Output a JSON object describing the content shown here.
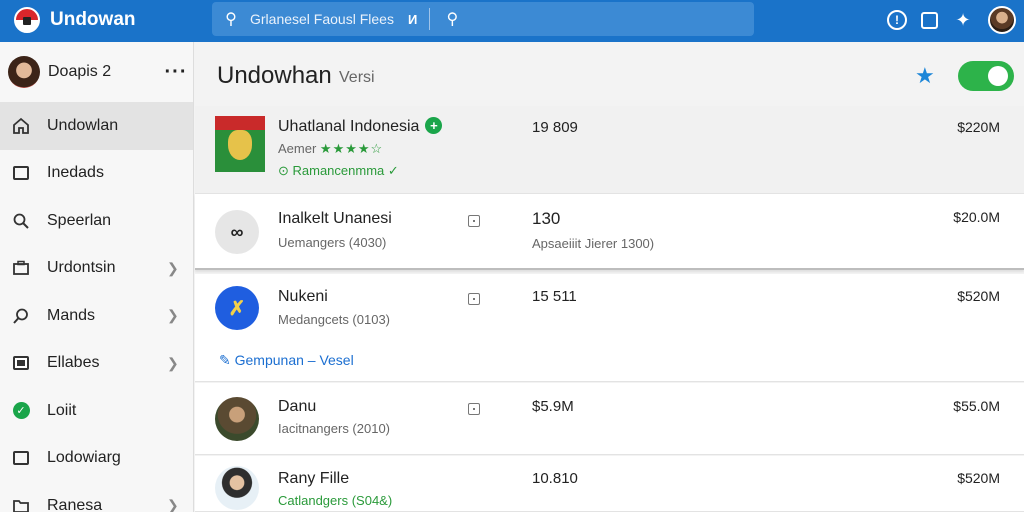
{
  "app": {
    "name": "Undowan"
  },
  "search": {
    "text": "Grlanesel Faousl Flees",
    "filter_label": "И"
  },
  "sidebar": {
    "user": {
      "name": "Doapis 2"
    },
    "items": [
      {
        "label": "Undowlan",
        "icon": "home-icon"
      },
      {
        "label": "Inedads",
        "icon": "inbox-icon"
      },
      {
        "label": "Speerlan",
        "icon": "search-icon"
      },
      {
        "label": "Urdontsin",
        "icon": "briefcase-icon"
      },
      {
        "label": "Mands",
        "icon": "magnifier-icon"
      },
      {
        "label": "Ellabes",
        "icon": "list-icon"
      },
      {
        "label": "Loiit",
        "icon": "check-icon"
      },
      {
        "label": "Lodowiarg",
        "icon": "message-icon"
      },
      {
        "label": "Ranesa",
        "icon": "folder-icon"
      }
    ]
  },
  "header": {
    "title": "Undowhan",
    "subtitle": "Versi"
  },
  "rows": [
    {
      "name": "Uhatlanal Indonesia",
      "sub_prefix": "Aemer",
      "stars": "★★★★☆",
      "link": "⊙ Ramancenmma ✓",
      "value": "19 809",
      "price": "$220M"
    },
    {
      "name": "Inalkelt Unanesi",
      "sub": "Uemangers (4030)",
      "value": "130",
      "value_sub": "Apsaeiiit Jierer 1300)",
      "price": "$20.0M"
    },
    {
      "name": "Nukeni",
      "sub": "Medangcets (0103)",
      "link": "Gempunan – Vesel",
      "value": "15 511",
      "price": "$520M"
    },
    {
      "name": "Danu",
      "sub": "Iacitnangers (2010)",
      "value": "$5.9M",
      "price": "$55.0M"
    },
    {
      "name": "Rany Fille",
      "sub": "Catlandgers (S04&)",
      "value": "10.810",
      "price": "$520M"
    }
  ]
}
